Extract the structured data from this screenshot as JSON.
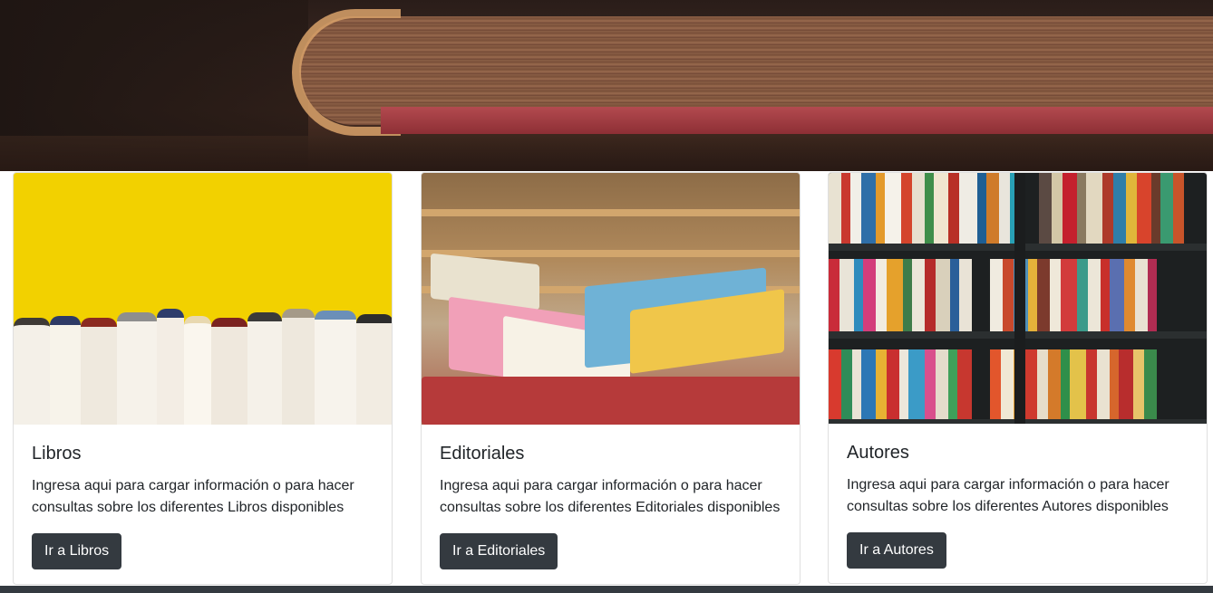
{
  "cards": [
    {
      "title": "Libros",
      "text": "Ingresa aqui para cargar información o para hacer consultas sobre los diferentes Libros disponibles",
      "button": "Ir a Libros",
      "image": "books-on-yellow-background"
    },
    {
      "title": "Editoriales",
      "text": "Ingresa aqui para cargar información o para hacer consultas sobre los diferentes Editoriales disponibles",
      "button": "Ir a Editoriales",
      "image": "bookstore-display"
    },
    {
      "title": "Autores",
      "text": "Ingresa aqui para cargar información o para hacer consultas sobre los diferentes Autores disponibles",
      "button": "Ir a Autores",
      "image": "bookshelf"
    }
  ],
  "colors": {
    "button_bg": "#343a40",
    "footer_bg": "#343a40",
    "card_border": "#dfdfdf"
  }
}
